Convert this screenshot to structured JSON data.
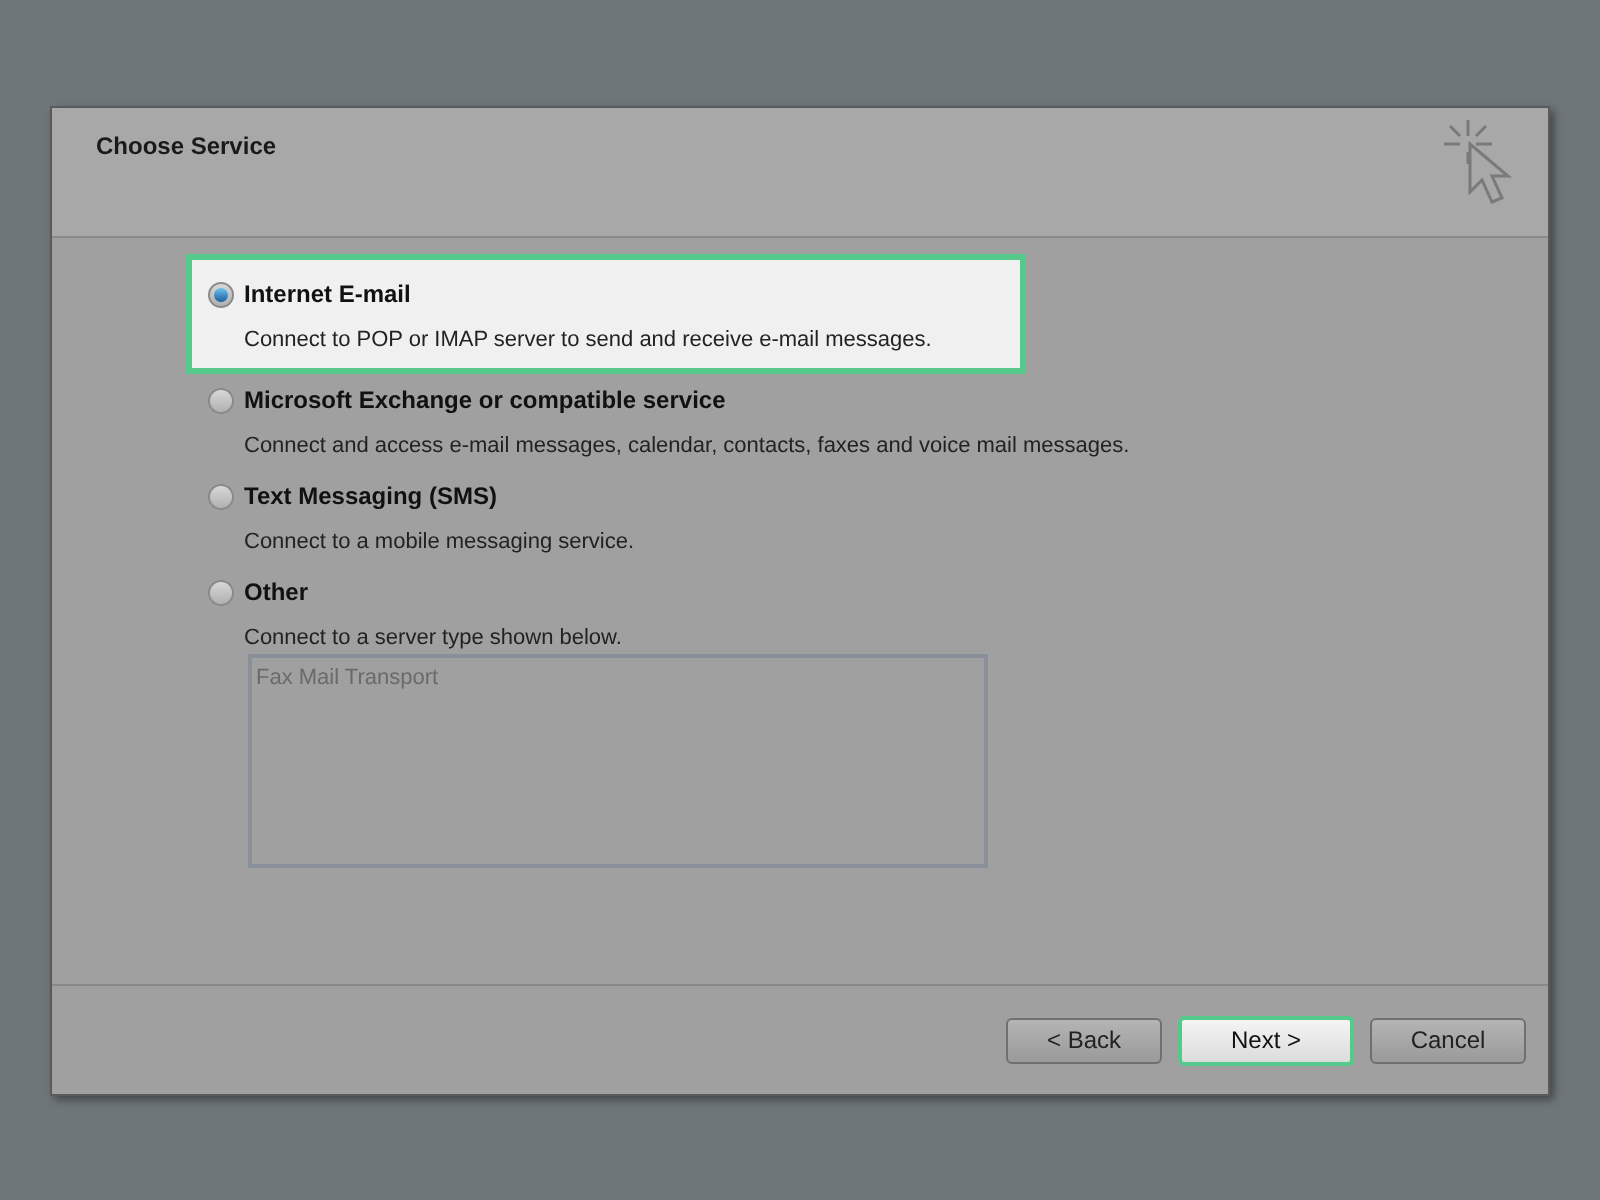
{
  "window": {
    "title": "Choose Service"
  },
  "options": [
    {
      "label": "Internet E-mail",
      "description": "Connect to POP or IMAP server to send and receive e-mail messages.",
      "selected": true,
      "highlighted": true
    },
    {
      "label": "Microsoft Exchange or compatible service",
      "description": "Connect and access e-mail messages, calendar, contacts, faxes and voice mail messages.",
      "selected": false,
      "highlighted": false
    },
    {
      "label": "Text Messaging (SMS)",
      "description": "Connect to a mobile messaging service.",
      "selected": false,
      "highlighted": false
    },
    {
      "label": "Other",
      "description": "Connect to a server type shown below.",
      "selected": false,
      "highlighted": false
    }
  ],
  "server_types": {
    "items": [
      "Fax Mail Transport"
    ],
    "disabled": true
  },
  "buttons": [
    {
      "label": "< Back",
      "highlighted": false
    },
    {
      "label": "Next >",
      "highlighted": true
    },
    {
      "label": "Cancel",
      "highlighted": false
    }
  ]
}
